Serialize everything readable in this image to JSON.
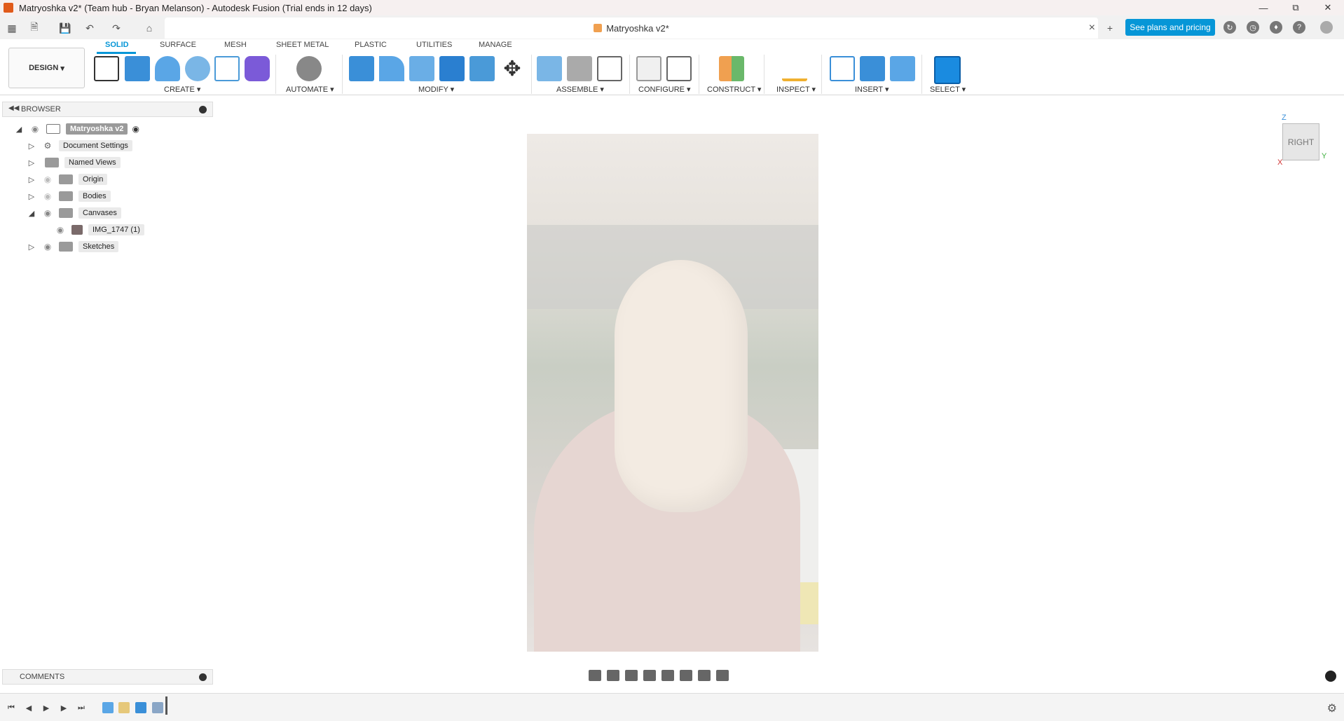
{
  "window": {
    "title": "Matryoshka v2* (Team hub - Bryan Melanson) - Autodesk Fusion (Trial ends in 12 days)",
    "controls": [
      "minimize",
      "restore",
      "close"
    ]
  },
  "tabbar": {
    "doc_tab_label": "Matryoshka v2*",
    "plans_button": "See plans and pricing"
  },
  "ribbon": {
    "workspace": "DESIGN",
    "tabs": [
      "SOLID",
      "SURFACE",
      "MESH",
      "SHEET METAL",
      "PLASTIC",
      "UTILITIES",
      "MANAGE"
    ],
    "active_tab": "SOLID",
    "groups": [
      "CREATE",
      "AUTOMATE",
      "MODIFY",
      "ASSEMBLE",
      "CONFIGURE",
      "CONSTRUCT",
      "INSPECT",
      "INSERT",
      "SELECT"
    ]
  },
  "browser": {
    "header": "BROWSER",
    "root": "Matryoshka v2",
    "items": [
      {
        "label": "Document Settings"
      },
      {
        "label": "Named Views"
      },
      {
        "label": "Origin"
      },
      {
        "label": "Bodies"
      },
      {
        "label": "Canvases"
      },
      {
        "label": "IMG_1747 (1)"
      },
      {
        "label": "Sketches"
      }
    ]
  },
  "viewcube": {
    "face": "RIGHT",
    "axes": {
      "z": "Z",
      "x": "X",
      "y": "Y"
    }
  },
  "comments": {
    "label": "COMMENTS"
  },
  "colors": {
    "accent": "#0696d7",
    "titlebar_bg": "#f6f0f0",
    "app_icon": "#e05a1a"
  }
}
